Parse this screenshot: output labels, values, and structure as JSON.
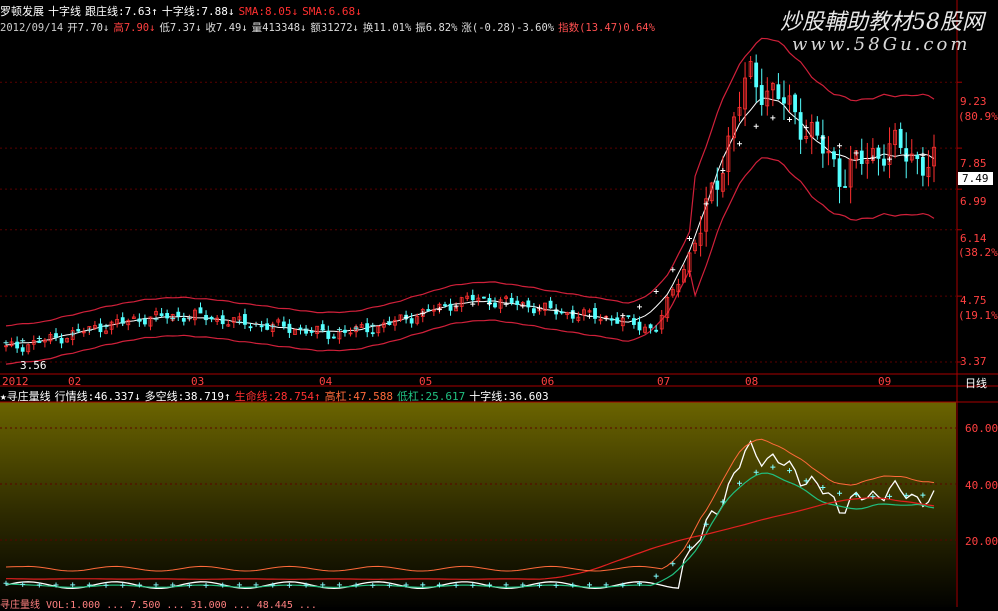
{
  "header": {
    "stock_name": "罗顿发展",
    "indicator_name": "十字线",
    "gen_zhuang_label": "跟庄线:7.63↑",
    "shizi_label": "十字线:7.88↓",
    "sma1_label": "SMA:8.05↓",
    "sma2_label": "SMA:6.68↓"
  },
  "quote": {
    "date": "2012/09/14",
    "open": "开7.70↓",
    "high": "高7.90↓",
    "low": "低7.37↓",
    "close": "收7.49↓",
    "volume": "量413348↓",
    "amount": "额31272↓",
    "turnover": "换11.01%",
    "amplitude": "振6.82%",
    "change": "涨(-0.28)-3.60%",
    "index": "指数(13.47)0.64%"
  },
  "watermark": {
    "line1": "炒股輔助教材58股网",
    "line2": "www.58Gu.com"
  },
  "price_axis": {
    "labels": [
      "9.23",
      "(80.9%)",
      "7.85",
      "7.49",
      "6.99",
      "6.14",
      "(38.2%)",
      "4.75",
      "(19.1%)",
      "3.37"
    ],
    "current": "7.49",
    "low_marker": "3.56"
  },
  "time_axis": {
    "labels": [
      "2012",
      "02",
      "03",
      "04",
      "05",
      "06",
      "07",
      "08",
      "09"
    ],
    "period": "日线"
  },
  "sub_header": {
    "name": "★寻庄量线",
    "xingqing": "行情线:46.337↓",
    "duokong": "多空线:38.719↑",
    "shengming": "生命线:28.754↑",
    "gaogang": "高杠:47.588",
    "digang": "低杠:25.617",
    "shizi": "十字线:36.603"
  },
  "sub_axis": {
    "labels": [
      "60.00",
      "40.00",
      "20.00"
    ]
  },
  "bottom_text": "寻庄量线  VOL:1.000 ... 7.500 ... 31.000 ... 48.445 ...",
  "colors": {
    "up": "#ff3030",
    "down": "#54ffff",
    "band": "#d0203a",
    "cross": "#ffffff",
    "cyan_cross": "#7ff0f0",
    "sub_bg_top": "#6b6400",
    "sub_bg_bottom": "#020200",
    "axis_red": "#a80000",
    "white_line": "#ffffff",
    "green_line": "#20c080",
    "orange_line": "#ff6a3a",
    "red_line": "#e02020"
  },
  "chart_data": {
    "type": "candlestick",
    "price_range": [
      3.37,
      9.8
    ],
    "period": "daily",
    "candles": [
      {
        "t": "2012-01",
        "o": 3.75,
        "h": 3.85,
        "l": 3.56,
        "c": 3.65
      },
      {
        "t": "2012-01b",
        "o": 3.65,
        "h": 3.9,
        "l": 3.6,
        "c": 3.85
      },
      {
        "t": "2012-02",
        "o": 3.9,
        "h": 4.2,
        "l": 3.85,
        "c": 4.1
      },
      {
        "t": "2012-02b",
        "o": 4.1,
        "h": 4.4,
        "l": 4.0,
        "c": 4.3
      },
      {
        "t": "2012-03",
        "o": 4.4,
        "h": 4.6,
        "l": 4.2,
        "c": 4.35
      },
      {
        "t": "2012-03b",
        "o": 4.35,
        "h": 4.45,
        "l": 4.1,
        "c": 4.2
      },
      {
        "t": "2012-03c",
        "o": 4.2,
        "h": 4.3,
        "l": 4.0,
        "c": 4.1
      },
      {
        "t": "2012-04",
        "o": 4.1,
        "h": 4.2,
        "l": 3.85,
        "c": 3.95
      },
      {
        "t": "2012-04b",
        "o": 3.95,
        "h": 4.2,
        "l": 3.9,
        "c": 4.1
      },
      {
        "t": "2012-05",
        "o": 4.1,
        "h": 4.5,
        "l": 4.05,
        "c": 4.4
      },
      {
        "t": "2012-05b",
        "o": 4.4,
        "h": 4.8,
        "l": 4.3,
        "c": 4.7
      },
      {
        "t": "2012-06",
        "o": 4.7,
        "h": 4.95,
        "l": 4.5,
        "c": 4.6
      },
      {
        "t": "2012-06b",
        "o": 4.6,
        "h": 4.7,
        "l": 4.3,
        "c": 4.4
      },
      {
        "t": "2012-07",
        "o": 4.4,
        "h": 4.5,
        "l": 4.2,
        "c": 4.3
      },
      {
        "t": "2012-07b",
        "o": 4.3,
        "h": 4.35,
        "l": 3.95,
        "c": 4.05
      },
      {
        "t": "2012-08",
        "o": 4.2,
        "h": 6.4,
        "l": 4.1,
        "c": 6.2
      },
      {
        "t": "2012-08b",
        "o": 6.3,
        "h": 9.9,
        "l": 6.1,
        "c": 9.4
      },
      {
        "t": "2012-08c",
        "o": 9.4,
        "h": 9.6,
        "l": 8.3,
        "c": 8.6
      },
      {
        "t": "2012-09",
        "o": 8.6,
        "h": 8.8,
        "l": 7.0,
        "c": 7.3
      },
      {
        "t": "2012-09b",
        "o": 7.3,
        "h": 8.5,
        "l": 7.2,
        "c": 7.9
      },
      {
        "t": "2012-09-14",
        "o": 7.7,
        "h": 7.9,
        "l": 7.37,
        "c": 7.49
      }
    ],
    "sub_indicator": {
      "range": [
        0,
        70
      ],
      "series": [
        {
          "name": "行情线",
          "last": 46.337
        },
        {
          "name": "多空线",
          "last": 38.719
        },
        {
          "name": "生命线",
          "last": 28.754
        },
        {
          "name": "高杠",
          "last": 47.588
        },
        {
          "name": "低杠",
          "last": 25.617
        },
        {
          "name": "十字线",
          "last": 36.603
        }
      ]
    }
  }
}
